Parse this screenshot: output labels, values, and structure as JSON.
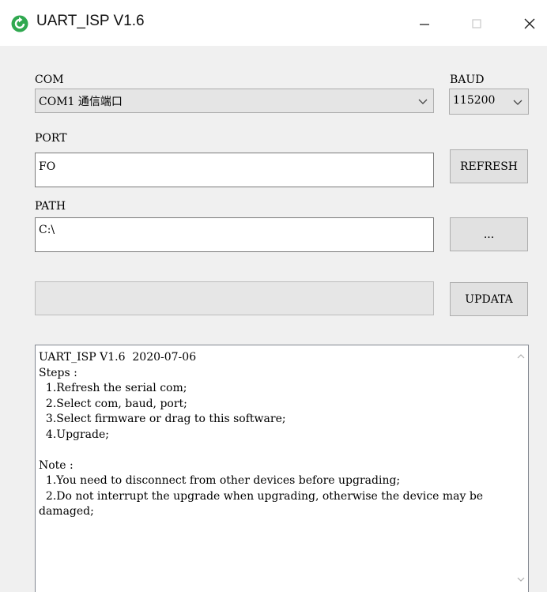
{
  "window": {
    "title": "UART_ISP V1.6",
    "icon": "green-refresh-icon",
    "controls": [
      "minimize-icon",
      "maximize-icon",
      "close-icon"
    ]
  },
  "com": {
    "label": "COM",
    "selected": "COM1 通信端口"
  },
  "baud": {
    "label": "BAUD",
    "selected": "115200"
  },
  "port": {
    "label": "PORT",
    "value": "FO",
    "refresh_label": "REFRESH"
  },
  "path": {
    "label": "PATH",
    "value": "C:\\",
    "browse_label": "..."
  },
  "update": {
    "progress": 0,
    "button_label": "UPDATA"
  },
  "log": {
    "text": "UART_ISP V1.6  2020-07-06\nSteps :\n  1.Refresh the serial com;\n  2.Select com, baud, port;\n  3.Select firmware or drag to this software;\n  4.Upgrade;\n\nNote :\n  1.You need to disconnect from other devices before upgrading;\n  2.Do not interrupt the upgrade when upgrading, otherwise the device may be damaged;"
  },
  "colors": {
    "accent": "#2fa84f",
    "window_bg": "#f0f0f0",
    "titlebar_bg": "#ffffff"
  }
}
